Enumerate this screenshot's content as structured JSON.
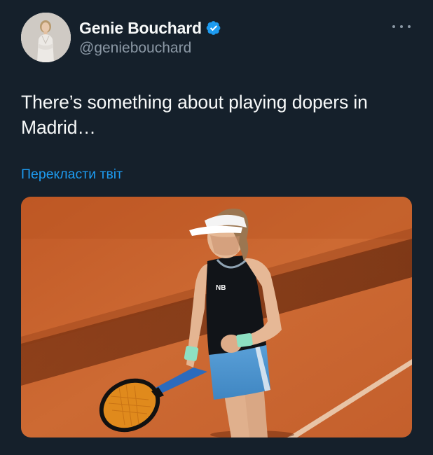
{
  "author": {
    "display_name": "Genie Bouchard",
    "handle": "@geniebouchard",
    "verified": true,
    "avatar_icon": "profile-photo"
  },
  "tweet": {
    "text_line1": "There’s something about playing dopers in",
    "text_line2": "Madrid…",
    "translate_label": "Перекласти твіт"
  },
  "media": {
    "type": "photo",
    "logo_text": "NB"
  },
  "colors": {
    "background": "#15202b",
    "text_primary": "#f7f9f9",
    "text_secondary": "#8b98a5",
    "accent": "#1d9bf0",
    "verified_badge": "#1d9bf0",
    "clay_court": "#c8642e"
  },
  "icons": {
    "verified": "verified-badge-icon",
    "more": "more-options-icon"
  }
}
